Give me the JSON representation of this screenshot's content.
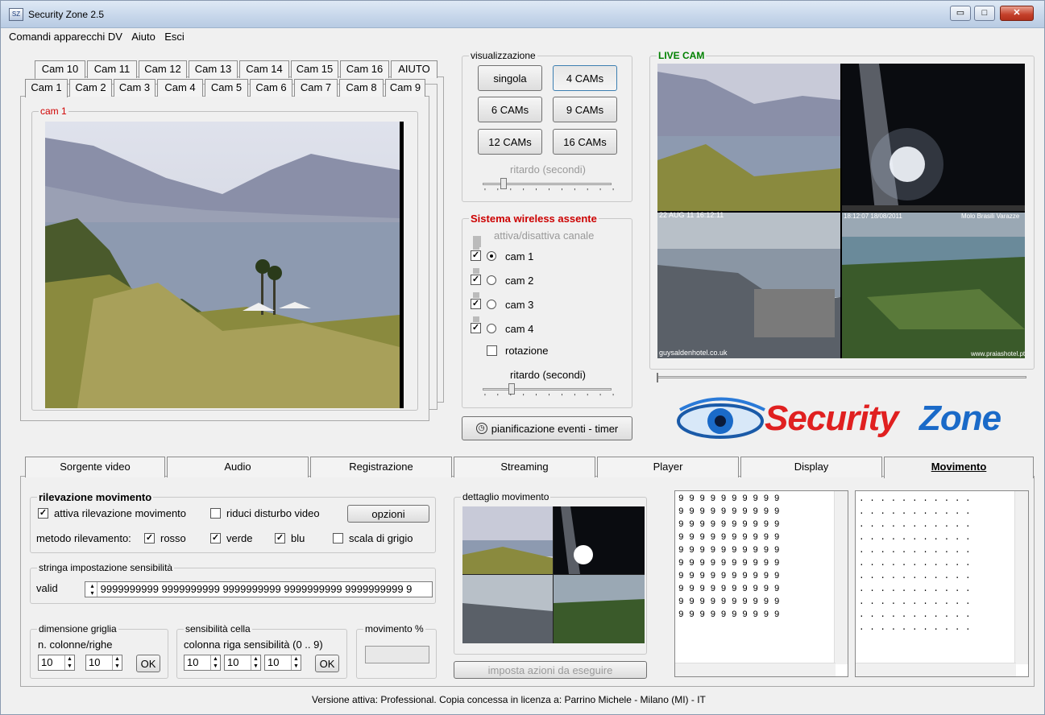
{
  "window": {
    "title": "Security Zone 2.5",
    "min": "▭",
    "max": "□",
    "close": "✕"
  },
  "menu": [
    "Comandi apparecchi DV",
    "Aiuto",
    "Esci"
  ],
  "cam_tabs_row1": [
    "Cam 10",
    "Cam 11",
    "Cam 12",
    "Cam 13",
    "Cam 14",
    "Cam 15",
    "Cam 16",
    "AIUTO"
  ],
  "cam_tabs_row2": [
    "Cam 1",
    "Cam 2",
    "Cam 3",
    "Cam 4",
    "Cam 5",
    "Cam 6",
    "Cam 7",
    "Cam 8",
    "Cam 9"
  ],
  "cam_panel": {
    "label": "cam 1"
  },
  "visualizzazione": {
    "label": "visualizzazione",
    "buttons": [
      "singola",
      "4 CAMs",
      "6 CAMs",
      "9 CAMs",
      "12 CAMs",
      "16 CAMs"
    ],
    "delay_label": "ritardo (secondi)"
  },
  "wireless": {
    "label": "Sistema wireless assente",
    "channel_label": "attiva/disattiva canale",
    "cams": [
      "cam 1",
      "cam 2",
      "cam 3",
      "cam 4"
    ],
    "rotation_label": "rotazione",
    "delay_label": "ritardo (secondi)"
  },
  "timer_button": "pianificazione eventi - timer",
  "live_cam": {
    "label": "LIVE CAM",
    "overlays": [
      "22 AUG 11 16:12:11",
      "18:12:07 18/08/2011",
      "Molo Brasili Varazze",
      "guysaldenhotel.co.uk",
      "www.praiashotel.pt"
    ]
  },
  "logo": {
    "word1": "Security",
    "word2": "Zone"
  },
  "bottom_tabs": [
    "Sorgente video",
    "Audio",
    "Registrazione",
    "Streaming",
    "Player",
    "Display",
    "Movimento"
  ],
  "rilevazione": {
    "label": "rilevazione movimento",
    "attiva": "attiva rilevazione movimento",
    "riduci": "riduci disturbo video",
    "opzioni": "opzioni",
    "metodo": "metodo rilevamento:",
    "rosso": "rosso",
    "verde": "verde",
    "blu": "blu",
    "grigio": "scala di grigio"
  },
  "stringa": {
    "label": "stringa impostazione sensibilità",
    "valid": "valid",
    "value": "9999999999 9999999999 9999999999 9999999999 9999999999 9"
  },
  "griglia": {
    "label": "dimensione griglia",
    "sub": "n. colonne/righe",
    "cols": "10",
    "rows": "10",
    "ok": "OK"
  },
  "cella": {
    "label": "sensibilità cella",
    "sub": "colonna  riga  sensibilità (0 .. 9)",
    "col": "10",
    "row": "10",
    "sens": "10",
    "ok": "OK"
  },
  "movimento_pct": {
    "label": "movimento %"
  },
  "dettaglio": {
    "label": "dettaglio movimento",
    "button": "imposta azioni da eseguire"
  },
  "grid_rows": [
    "9 9 9 9 9 9 9 9 9 9",
    "9 9 9 9 9 9 9 9 9 9",
    "9 9 9 9 9 9 9 9 9 9",
    "9 9 9 9 9 9 9 9 9 9",
    "9 9 9 9 9 9 9 9 9 9",
    "9 9 9 9 9 9 9 9 9 9",
    "9 9 9 9 9 9 9 9 9 9",
    "9 9 9 9 9 9 9 9 9 9",
    "9 9 9 9 9 9 9 9 9 9",
    "9 9 9 9 9 9 9 9 9 9"
  ],
  "dot_rows": [
    ". . . . . . . . . . .",
    ". . . . . . . . . . .",
    ". . . . . . . . . . .",
    ". . . . . . . . . . .",
    ". . . . . . . . . . .",
    ". . . . . . . . . . .",
    ". . . . . . . . . . .",
    ". . . . . . . . . . .",
    ". . . . . . . . . . .",
    ". . . . . . . . . . .",
    ". . . . . . . . . . ."
  ],
  "status": "Versione attiva: Professional. Copia concessa in licenza a: Parrino Michele - Milano (MI) - IT"
}
